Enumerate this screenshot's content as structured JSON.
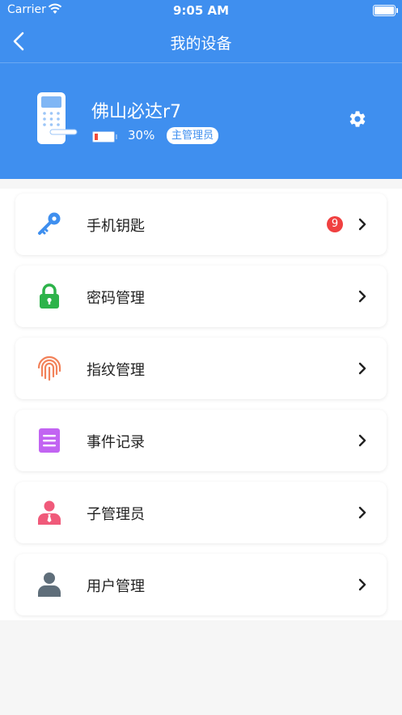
{
  "status_bar": {
    "carrier": "Carrier",
    "time": "9:05 AM"
  },
  "nav": {
    "title": "我的设备"
  },
  "device": {
    "name": "佛山必达r7",
    "battery_percent": "30%",
    "battery_level": 0.3,
    "role": "主管理员"
  },
  "menu": [
    {
      "label": "手机钥匙",
      "icon": "key-icon",
      "color": "#3f8fef",
      "badge": "9"
    },
    {
      "label": "密码管理",
      "icon": "padlock-icon",
      "color": "#2db34a"
    },
    {
      "label": "指纹管理",
      "icon": "fingerprint-icon",
      "color": "#f2825a"
    },
    {
      "label": "事件记录",
      "icon": "document-icon",
      "color": "#c264f2"
    },
    {
      "label": "子管理员",
      "icon": "admin-user-icon",
      "color": "#f05a7a"
    },
    {
      "label": "用户管理",
      "icon": "user-icon",
      "color": "#5f6e7a"
    }
  ],
  "colors": {
    "primary": "#3f8fef",
    "badge": "#f04040",
    "background": "#f6f6f6"
  }
}
